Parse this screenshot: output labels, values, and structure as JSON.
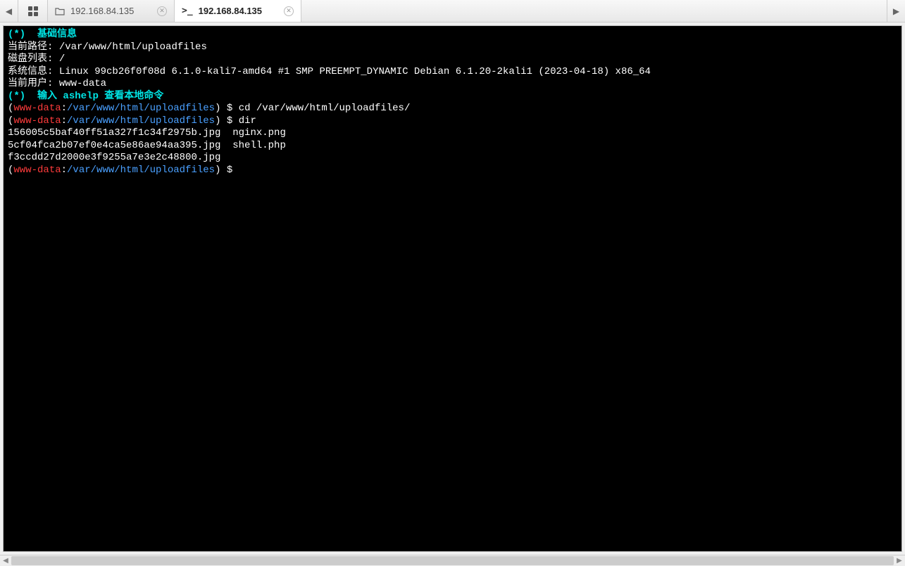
{
  "tabs": {
    "tab1": {
      "label": "192.168.84.135"
    },
    "tab2": {
      "label": "192.168.84.135"
    }
  },
  "terminal": {
    "header": {
      "star": "(*)",
      "basic_info": "基础信息",
      "path_label": "当前路径:",
      "path_value": "/var/www/html/uploadfiles",
      "disk_label": "磁盘列表:",
      "disk_value": "/",
      "sys_label": "系统信息:",
      "sys_value": "Linux 99cb26f0f08d 6.1.0-kali7-amd64 #1 SMP PREEMPT_DYNAMIC Debian 6.1.20-2kali1 (2023-04-18) x86_64",
      "user_label": "当前用户:",
      "user_value": "www-data",
      "help_hint": "输入 ashelp 查看本地命令"
    },
    "prompt": {
      "open": "(",
      "user": "www-data",
      "sep": ":",
      "cwd": "/var/www/html/uploadfiles",
      "close": ")",
      "dollar": " $ "
    },
    "commands": {
      "cd": "cd /var/www/html/uploadfiles/",
      "dir": "dir"
    },
    "output": {
      "line1": "156005c5baf40ff51a327f1c34f2975b.jpg  nginx.png",
      "line2": "5cf04fca2b07ef0e4ca5e86ae94aa395.jpg  shell.php",
      "line3": "f3ccdd27d2000e3f9255a7e3e2c48800.jpg"
    }
  }
}
